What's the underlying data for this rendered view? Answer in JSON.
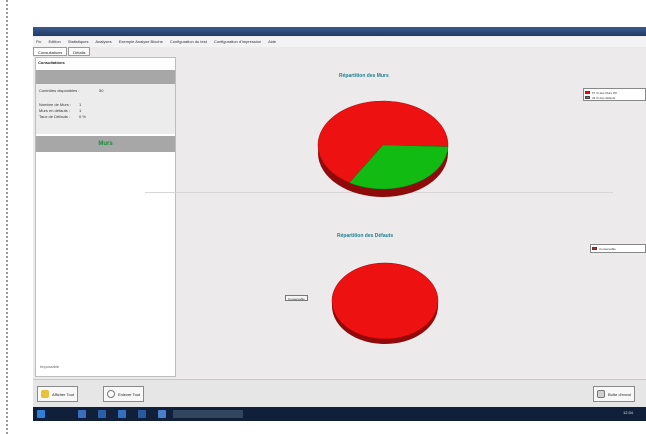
{
  "menubar": {
    "items": [
      "Fic",
      "Edition",
      "Statistiques",
      "Analyses",
      "Exemple Analyse Bloche",
      "Configuration du test",
      "Configuration d'impression",
      "Aide"
    ]
  },
  "tabs": [
    {
      "label": "Consultations"
    },
    {
      "label": "Détails"
    }
  ],
  "left_panel": {
    "title": "Consultations",
    "stats": [
      {
        "label": "Contrôles disponibles :",
        "value": "50"
      },
      {
        "label": "Nombre de Murs :",
        "value": "1"
      },
      {
        "label": "Murs en défauts :",
        "value": "1"
      },
      {
        "label": "Taux de Défauts :",
        "value": "0 %"
      }
    ],
    "heading": "Murs",
    "footer": "Impossible"
  },
  "charts": [
    {
      "title": "Répartition des Murs",
      "legend": [
        {
          "label": "67 % des Murs OK",
          "color": "#ee1111"
        },
        {
          "label": "33 % des défauts",
          "color": "#11bb11"
        }
      ]
    },
    {
      "title": "Répartition des Défauts",
      "legend": [
        {
          "label": "Conservable",
          "color": "#ee1111"
        }
      ],
      "slice_label": "Conservable"
    }
  ],
  "chart_data": [
    {
      "type": "pie",
      "title": "Répartition des Murs",
      "categories": [
        "Murs OK",
        "Défauts"
      ],
      "values": [
        67,
        33
      ],
      "colors": [
        "#ee1111",
        "#11bb11"
      ]
    },
    {
      "type": "pie",
      "title": "Répartition des Défauts",
      "categories": [
        "Conservable"
      ],
      "values": [
        100
      ],
      "colors": [
        "#ee1111"
      ]
    }
  ],
  "buttons": {
    "left1": "Afficher Tout",
    "left2": "Enlever Tout",
    "right": "Boîte d'envoi"
  },
  "taskbar": {
    "time": "12:34"
  },
  "colors": {
    "accent_title": "#1f7f8f",
    "heading_green": "#1a8a3a",
    "pie_red": "#ee1111",
    "pie_green": "#11bb11"
  }
}
